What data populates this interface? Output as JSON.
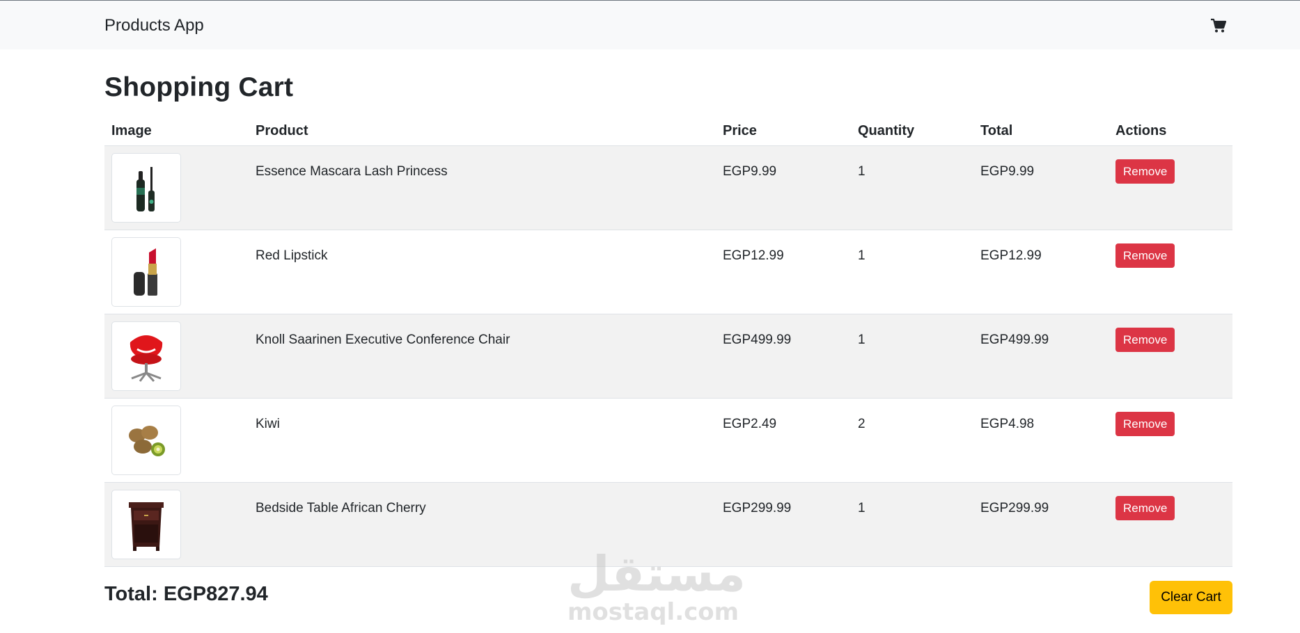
{
  "navbar": {
    "brand": "Products App",
    "cart_icon": "cart-icon"
  },
  "page": {
    "title": "Shopping Cart"
  },
  "table": {
    "headers": [
      "Image",
      "Product",
      "Price",
      "Quantity",
      "Total",
      "Actions"
    ],
    "rows": [
      {
        "product": "Essence Mascara Lash Princess",
        "price": "EGP9.99",
        "quantity": "1",
        "total": "EGP9.99",
        "action": "Remove",
        "image": "mascara-image"
      },
      {
        "product": "Red Lipstick",
        "price": "EGP12.99",
        "quantity": "1",
        "total": "EGP12.99",
        "action": "Remove",
        "image": "lipstick-image"
      },
      {
        "product": "Knoll Saarinen Executive Conference Chair",
        "price": "EGP499.99",
        "quantity": "1",
        "total": "EGP499.99",
        "action": "Remove",
        "image": "chair-image"
      },
      {
        "product": "Kiwi",
        "price": "EGP2.49",
        "quantity": "2",
        "total": "EGP4.98",
        "action": "Remove",
        "image": "kiwi-image"
      },
      {
        "product": "Bedside Table African Cherry",
        "price": "EGP299.99",
        "quantity": "1",
        "total": "EGP299.99",
        "action": "Remove",
        "image": "bedside-table-image"
      }
    ]
  },
  "summary": {
    "total": "Total: EGP827.94",
    "clear_label": "Clear Cart"
  },
  "watermark": {
    "arabic": "مستقل",
    "latin": "mostaql.com"
  },
  "colors": {
    "danger": "#dc3545",
    "warning": "#ffc107",
    "navbar_bg": "#f8f9fa",
    "stripe": "#f2f2f2"
  }
}
